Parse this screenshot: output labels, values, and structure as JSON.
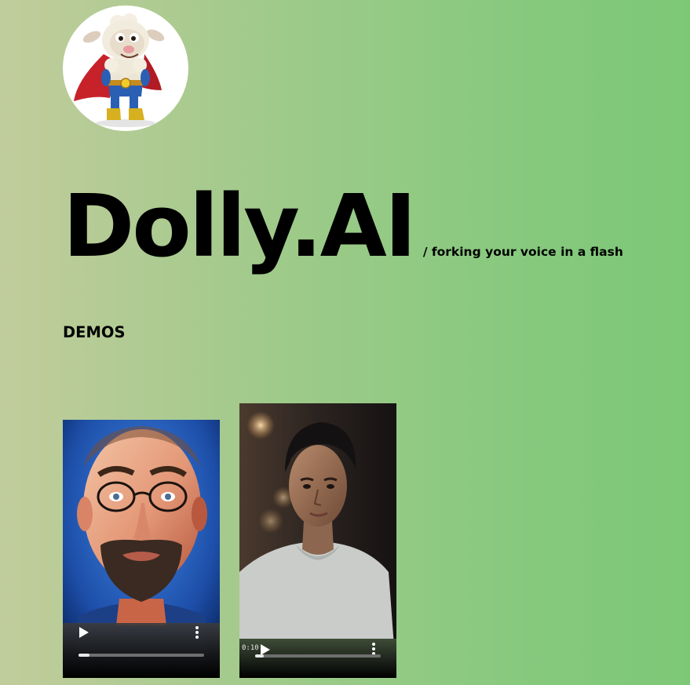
{
  "header": {
    "logo_icon": "superhero-sheep-avatar-icon"
  },
  "brand": {
    "title": "Dolly.AI",
    "tagline": "/ forking your voice in a flash"
  },
  "demos": {
    "heading": "DEMOS",
    "videos": [
      {
        "subject": "cartoon-bald-man-with-glasses",
        "play_icon": "play-icon",
        "menu_icon": "more-vertical-icon",
        "progress": 0.09
      },
      {
        "subject": "young-man-portrait",
        "time": "0:10",
        "play_icon": "play-icon",
        "menu_icon": "more-vertical-icon",
        "progress": 0.07
      }
    ]
  },
  "colors": {
    "background_left": "#c1cc9c",
    "background_right": "#7dc877",
    "text": "#000000"
  }
}
